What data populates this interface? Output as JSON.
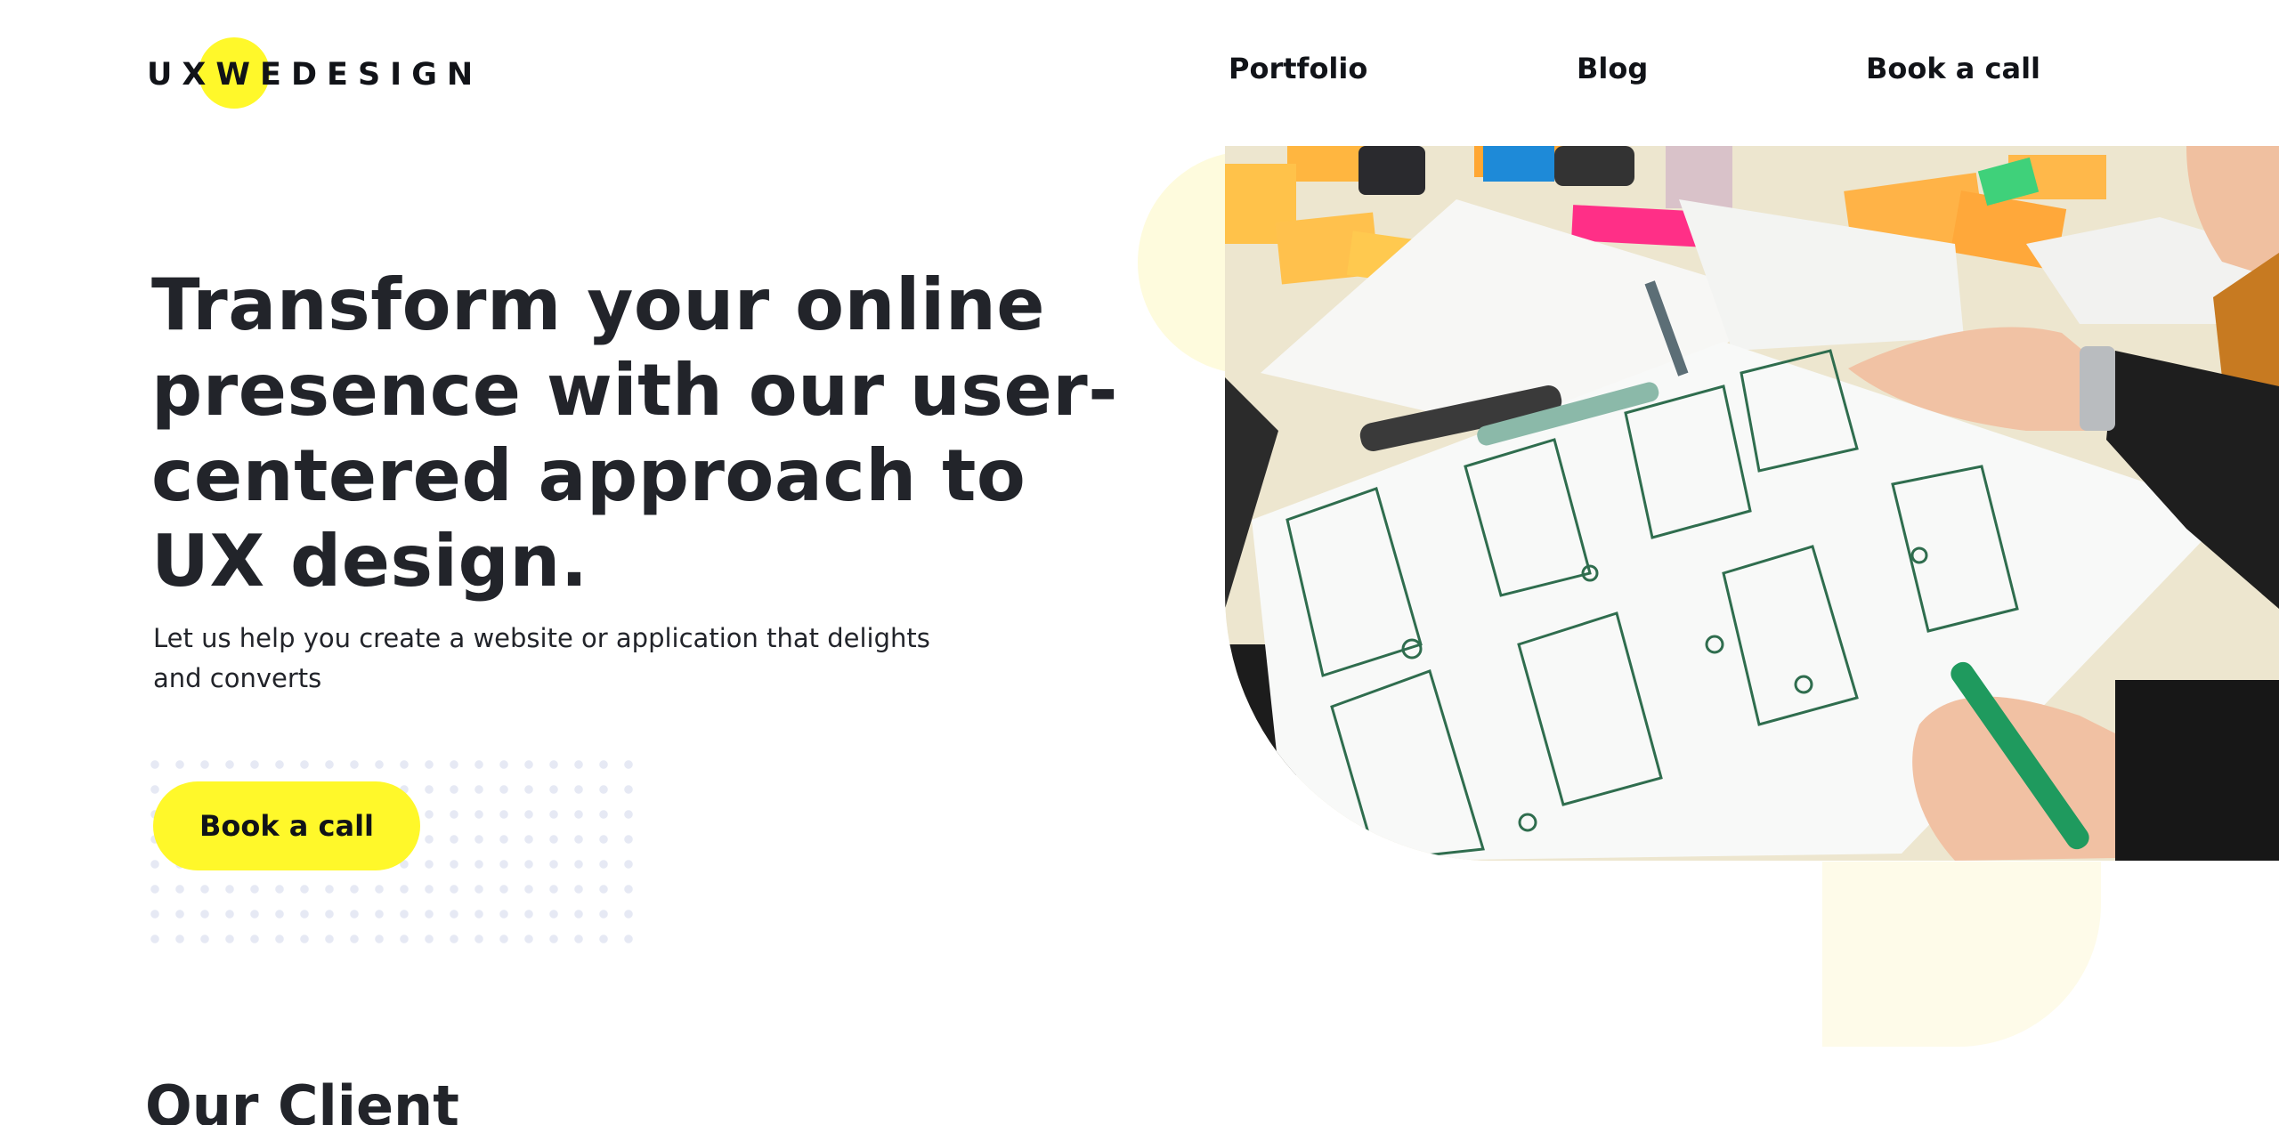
{
  "brand": {
    "logo_letters": [
      "U",
      "X",
      "W",
      "E",
      "D",
      "E",
      "S",
      "I",
      "G",
      "N"
    ],
    "accent_color": "#fff82a",
    "text_color": "#22242a"
  },
  "nav": {
    "items": [
      {
        "label": "Portfolio"
      },
      {
        "label": "Blog"
      },
      {
        "label": "Book a call"
      }
    ]
  },
  "hero": {
    "title": "Transform your online presence with our user-centered approach to UX design.",
    "subtitle": "Let us help you create a website or application that delights and converts",
    "cta_label": "Book a call",
    "image_icon": "design-workshop-photo"
  },
  "clients": {
    "heading": "Our Client"
  }
}
